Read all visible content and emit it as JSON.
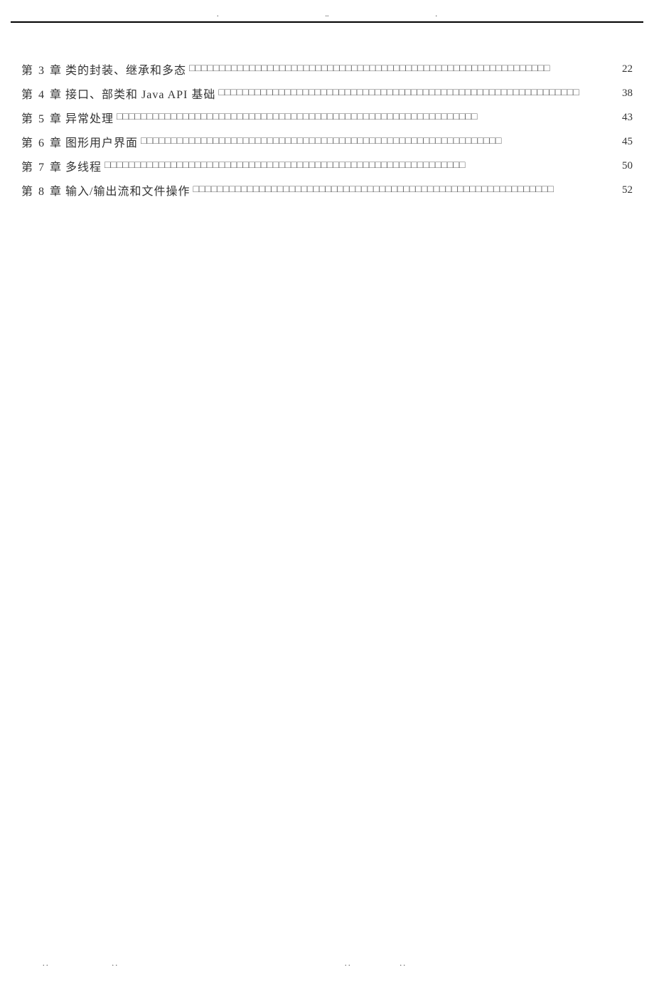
{
  "topDots": [
    ".",
    "..",
    "."
  ],
  "toc": [
    {
      "chapter": "第 3 章",
      "title": "类的封装、继承和多态",
      "page": "22"
    },
    {
      "chapter": "第 4 章",
      "title": "接口、部类和 Java API 基础",
      "page": "38"
    },
    {
      "chapter": "第 5 章",
      "title": "异常处理",
      "page": "43"
    },
    {
      "chapter": "第 6 章",
      "title": "图形用户界面",
      "page": "45"
    },
    {
      "chapter": "第 7 章",
      "title": "多线程",
      "page": "50"
    },
    {
      "chapter": "第 8 章",
      "title": "输入/输出流和文件操作",
      "page": "52"
    }
  ],
  "bottomDots": [
    ". .",
    ". .",
    ". .",
    ". ."
  ],
  "leaderChar": "□"
}
